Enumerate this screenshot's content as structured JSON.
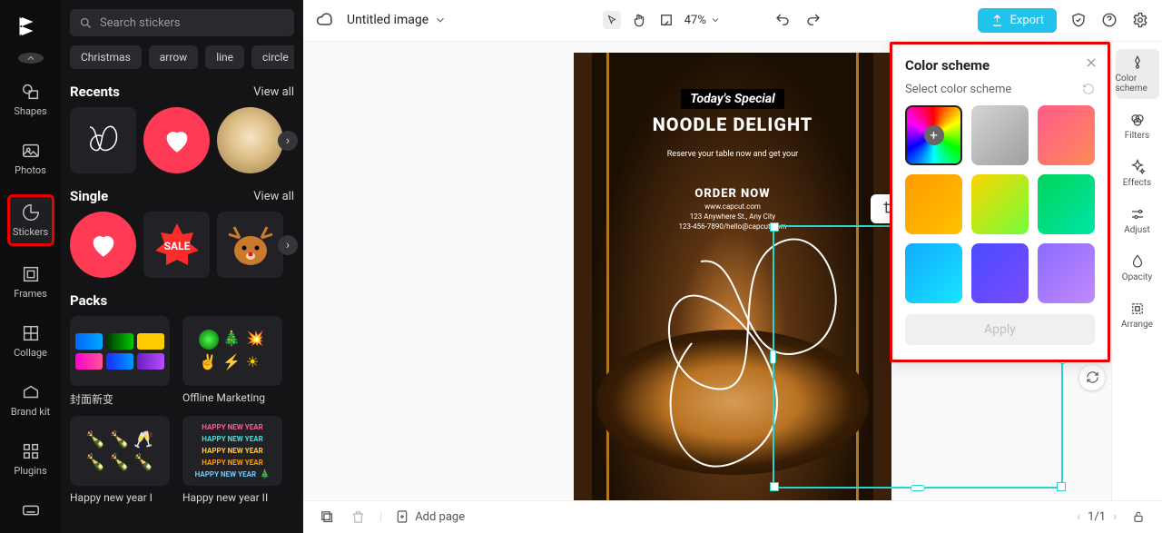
{
  "header": {
    "title": "Untitled image",
    "zoom": "47%",
    "export": "Export"
  },
  "search_placeholder": "Search stickers",
  "tags": [
    "Christmas",
    "arrow",
    "line",
    "circle"
  ],
  "sections": {
    "recents": {
      "title": "Recents",
      "viewall": "View all"
    },
    "single": {
      "title": "Single",
      "viewall": "View all"
    },
    "packs": {
      "title": "Packs"
    }
  },
  "pack_labels": [
    "封面新变",
    "Offline Marketing",
    "Happy new year I",
    "Happy new year II"
  ],
  "rail": [
    "Shapes",
    "Photos",
    "Stickers",
    "Frames",
    "Collage",
    "Brand kit",
    "Plugins"
  ],
  "rrail": [
    "Color scheme",
    "Filters",
    "Effects",
    "Adjust",
    "Opacity",
    "Arrange"
  ],
  "popup": {
    "title": "Color scheme",
    "sub": "Select color scheme",
    "apply": "Apply"
  },
  "artboard": {
    "todays": "Today's Special",
    "noodle": "NOODLE DELIGHT",
    "reserve": "Reserve your table now and get your",
    "order": "ORDER NOW",
    "www": "www.capcut.com",
    "addr": "123 Anywhere St., Any City",
    "phone": "123-456-7890/hello@capcut.com"
  },
  "bottom": {
    "addpage": "Add page",
    "pages": "1/1"
  }
}
